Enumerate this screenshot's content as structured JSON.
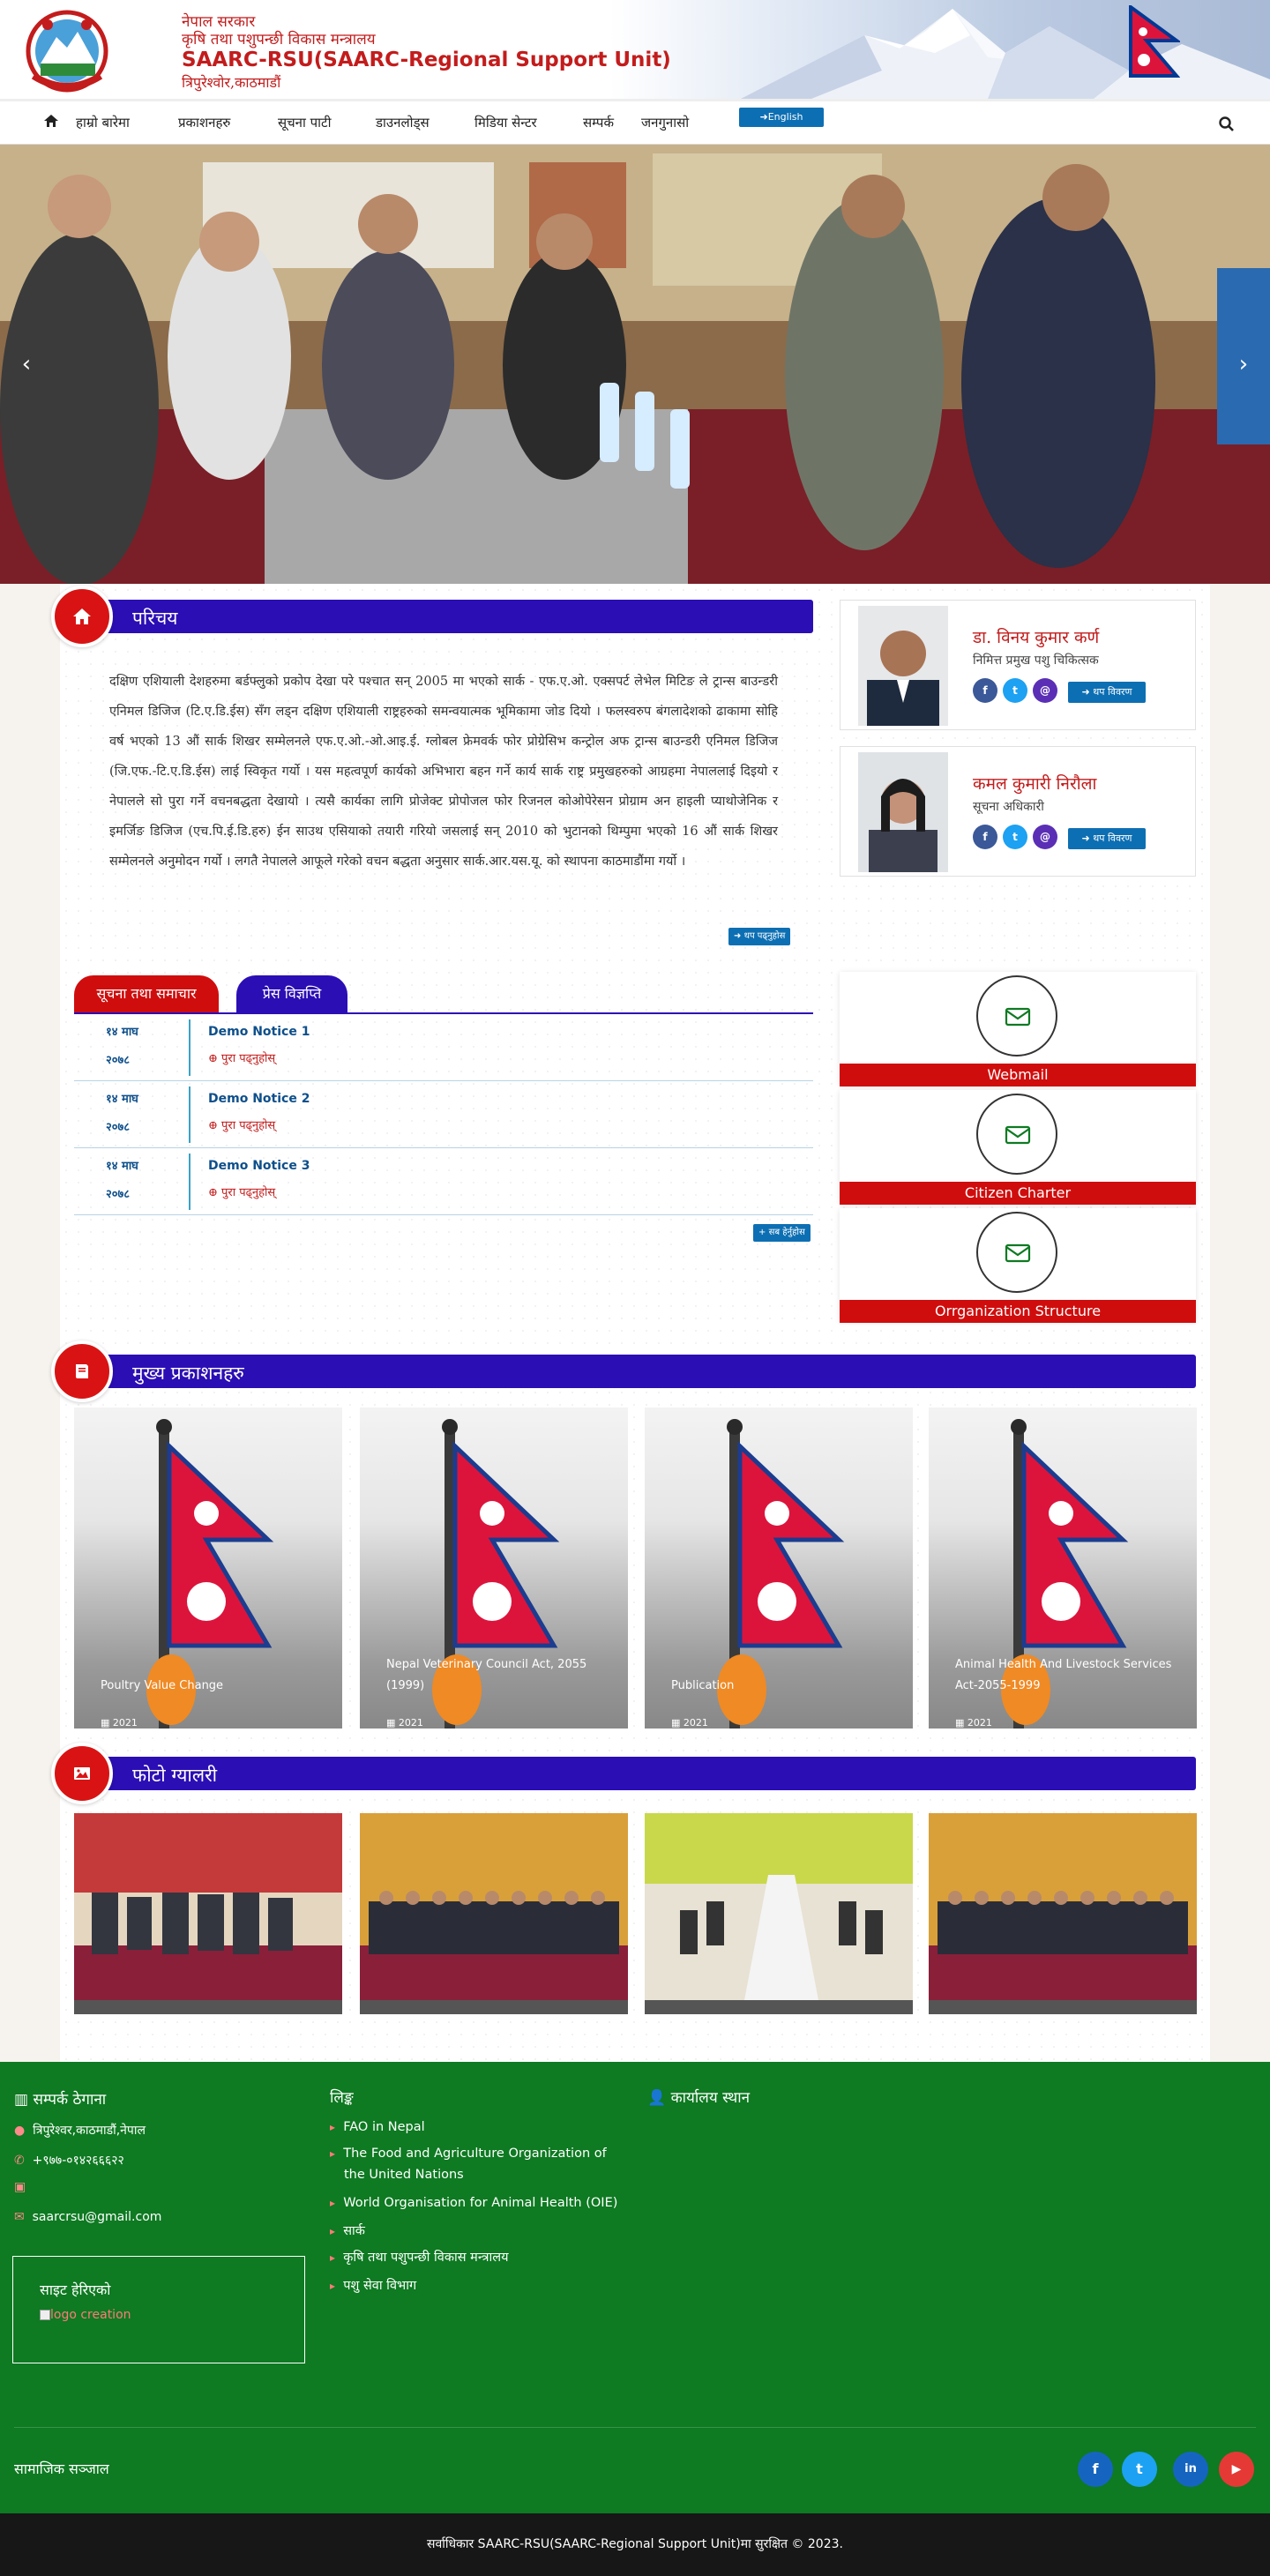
{
  "header": {
    "gov_line1": "नेपाल सरकार",
    "gov_line2": "कृषि तथा पशुपन्छी विकास मन्त्रालय",
    "org_name": "SAARC-RSU(SAARC-Regional Support Unit)",
    "address": "त्रिपुरेश्वोर,काठमाडौं"
  },
  "nav": {
    "items": [
      "हाम्रो बारेमा",
      "प्रकाशनहरु",
      "सूचना पाटी",
      "डाउनलोड्स",
      "मिडिया सेन्टर",
      "सम्पर्क",
      "जनगुनासो"
    ],
    "lang_label": "English"
  },
  "intro": {
    "title": "परिचय",
    "text": "दक्षिण एशियाली देशहरुमा बर्डफ्लुको प्रकोप देखा परे पश्चात सन् 2005 मा भएको सार्क - एफ.ए.ओ. एक्सपर्ट लेभेल मिटिङ ले ट्रान्स बाउन्डरी एनिमल डिजिज (टि.ए.डि.ईस) सँग लड्न दक्षिण एशियाली राष्ट्रहरुको समन्वयात्मक भूमिकामा जोड दियो । फलस्वरुप बंगलादेशको ढाकामा सोहि वर्ष भएको 13 औं सार्क शिखर सम्मेलनले एफ.ए.ओ.-ओ.आइ.ई. ग्लोबल फ्रेमवर्क फोर प्रोग्रेसिभ कन्ट्रोल अफ ट्रान्स बाउन्डरी एनिमल डिजिज (जि.एफ.-टि.ए.डि.ईस) लाई स्विकृत गर्यो । यस महत्वपूर्ण कार्यको अभिभारा बहन गर्ने कार्य सार्क राष्ट्र प्रमुखहरुको आग्रहमा नेपाललाई दिइयो र नेपालले सो पुरा गर्ने वचनबद्धता देखायो । त्यसै कार्यका लागि प्रोजेक्ट प्रोपोजल फोर रिजनल कोओपेरेसन प्रोग्राम अन हाइली प्याथोजेनिक र इमर्जिङ डिजिज (एच.पि.ई.डि.हरु) ईन साउथ एसियाको तयारी गरियो जसलाई सन् 2010 को भुटानको थिम्पुमा भएको 16 औं सार्क शिखर सम्मेलनले अनुमोदन गर्यो । लगतै नेपालले आफूले गरेको वचन बद्धता अनुसार सार्क.आर.यस.यू. को स्थापना काठमाडौंमा गर्यो ।",
    "more_label": "थप पढ्नुहोस"
  },
  "officials": [
    {
      "name": "डा. विनय कुमार कर्ण",
      "role": "निमित्त प्रमुख पशु चिकित्सक",
      "details_label": "थप विवरण"
    },
    {
      "name": "कमल कुमारी निरौला",
      "role": "सूचना अधिकारी",
      "details_label": "थप विवरण"
    }
  ],
  "social_letters": {
    "facebook": "f",
    "twitter": "t",
    "email": "@",
    "linkedin": "in",
    "youtube": "▶"
  },
  "notices": {
    "tab_news": "सूचना तथा समाचार",
    "tab_press": "प्रेस विज्ञप्ति",
    "items": [
      {
        "date1": "१४ माघ",
        "date2": "२०७८",
        "title": "Demo Notice 1",
        "read": "पुरा पढ्नुहोस्"
      },
      {
        "date1": "१४ माघ",
        "date2": "२०७८",
        "title": "Demo Notice 2",
        "read": "पुरा पढ्नुहोस्"
      },
      {
        "date1": "१४ माघ",
        "date2": "२०७८",
        "title": "Demo Notice 3",
        "read": "पुरा पढ्नुहोस्"
      }
    ],
    "all_label": "सब हेर्नुहोस"
  },
  "quick_links": [
    "Webmail",
    "Citizen Charter",
    "Orrganization Structure"
  ],
  "publications": {
    "title": "मुख्य प्रकाशनहरु",
    "items": [
      {
        "title": "Poultry Value Change",
        "year": "2021"
      },
      {
        "title": "Nepal Veterinary Council Act, 2055 (1999)",
        "year": "2021"
      },
      {
        "title": "Publication",
        "year": "2021"
      },
      {
        "title": "Animal Health And Livestock Services Act-2055-1999",
        "year": "2021"
      }
    ]
  },
  "gallery": {
    "title": "फोटो ग्यालरी"
  },
  "footer": {
    "contact_heading": "सम्पर्क ठेगाना",
    "address": "त्रिपुरेश्वर,काठमाडौं,नेपाल",
    "phone": "+९७७-०१४२६६६२२",
    "email": "saarcrsu@gmail.com",
    "links_heading": "लिङ्क",
    "links": [
      "FAO in Nepal",
      "The Food and Agriculture Organization of the United Nations",
      "World Organisation for Animal Health (OIE)",
      "सार्क",
      "कृषि तथा पशुपन्छी विकास मन्त्रालय",
      "पशु सेवा विभाग"
    ],
    "office_heading": "कार्यालय स्थान",
    "visits_heading": "साइट हेरिएको",
    "logo_alt": "logo creation",
    "social_label": "सामाजिक सञ्जाल",
    "copyright": "सर्वाधिकार SAARC-RSU(SAARC-Regional Support Unit)मा सुरक्षित © 2023."
  },
  "colors": {
    "brand_red": "#c31c1c",
    "section_blue": "#2c0eb5",
    "footer_green": "#0e7a22",
    "link_blue": "#0d6fb3"
  }
}
